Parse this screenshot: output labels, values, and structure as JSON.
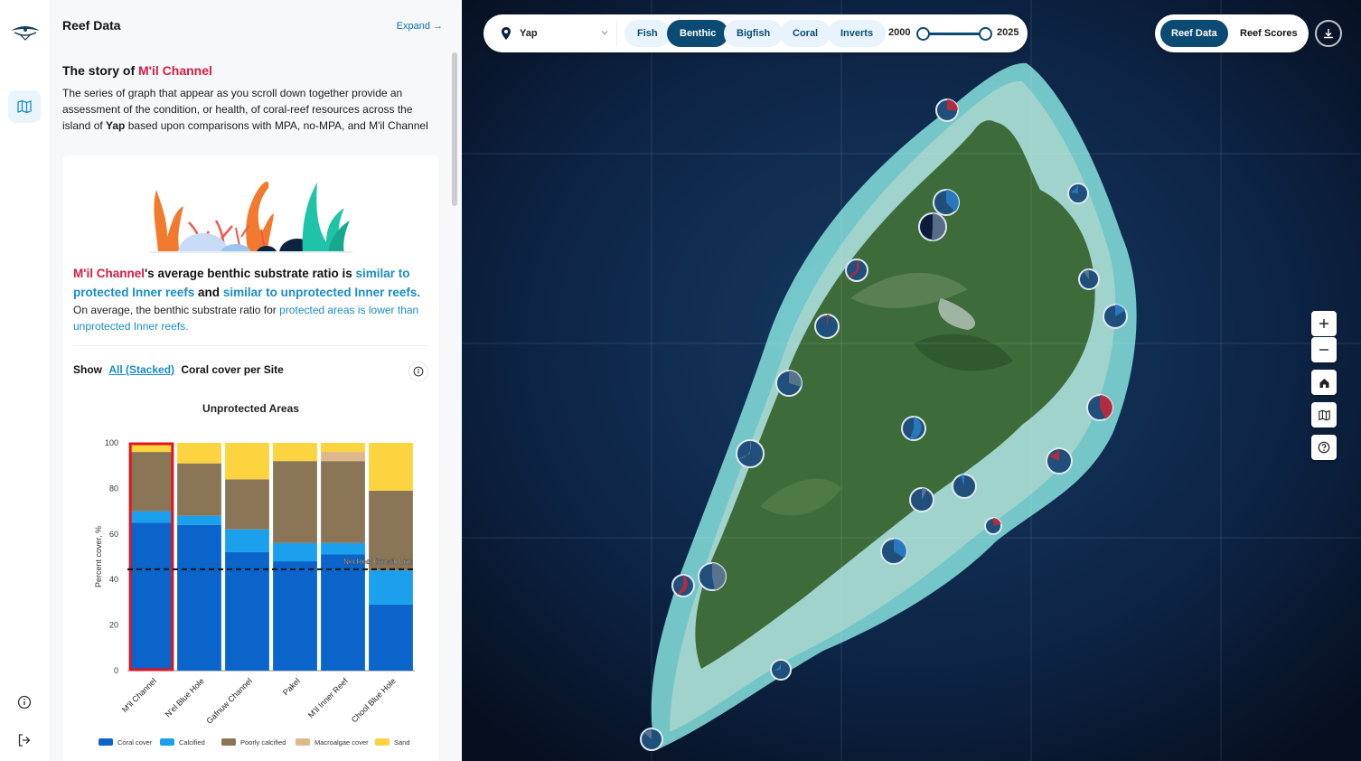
{
  "panel": {
    "title": "Reef Data",
    "expand": "Expand →"
  },
  "story": {
    "prefix": "The story of ",
    "site": "M'il Channel",
    "text_a": "The series of graph that appear as you scroll down together provide an assessment of the condition, or health, of coral-reef resources across the island of ",
    "island": "Yap",
    "text_b": " based upon comparisons with MPA, no-MPA, and M'il Channel"
  },
  "card": {
    "h_site": "M'il Channel",
    "h_a": "'s average benthic substrate ratio is ",
    "h_link1": "similar to protected Inner reefs",
    "h_and": " and ",
    "h_link2": "similar to unprotected Inner reefs.",
    "sub_a": "On average, the benthic substrate ratio for ",
    "sub_link": "protected areas is lower than unprotected Inner reefs.",
    "show": "Show",
    "show_sel": "All (Stacked)",
    "show_rest": "Coral cover per Site"
  },
  "chart_data": {
    "type": "bar",
    "stacked": true,
    "title": "Unprotected Areas",
    "ylabel": "Percent cover, %",
    "xlabel": "",
    "ylim": [
      0,
      100
    ],
    "yticks": [
      0,
      20,
      40,
      60,
      80,
      100
    ],
    "categories": [
      "M'il Channel",
      "N'el Blue Hole",
      "Gafnuw Channel",
      "Pakel",
      "M'il Inner Reef",
      "Chool Blue Hole"
    ],
    "highlight": "M'il Channel",
    "reference_line": {
      "label": "Net Reef Growth Line",
      "value": 44.5
    },
    "series": [
      {
        "name": "Coral cover",
        "color": "#0a64c9",
        "values": [
          65,
          64,
          52,
          48,
          51,
          29
        ]
      },
      {
        "name": "Calcified",
        "color": "#1aa0ec",
        "values": [
          5,
          4,
          10,
          8,
          5,
          15
        ]
      },
      {
        "name": "Poorly calcified",
        "color": "#8a7556",
        "values": [
          26,
          23,
          22,
          36,
          36,
          35
        ]
      },
      {
        "name": "Macroalgae cover",
        "color": "#ddb88d",
        "values": [
          0,
          0,
          0,
          0,
          4,
          0
        ]
      },
      {
        "name": "Sand",
        "color": "#fbd43f",
        "values": [
          4,
          9,
          16,
          8,
          4,
          21
        ]
      }
    ]
  },
  "map": {
    "location": "Yap",
    "layers": [
      "Fish",
      "Benthic",
      "Bigfish",
      "Coral",
      "Inverts"
    ],
    "active_layer": "Benthic",
    "year_start": "2000",
    "year_end": "2025",
    "views": [
      "Reef Data",
      "Reef Scores"
    ],
    "active_view": "Reef Data"
  },
  "icons": {
    "rail": [
      "map-icon",
      "info-icon",
      "logout-icon"
    ],
    "map_controls": [
      "zoom-in-icon",
      "zoom-out-icon",
      "home-icon",
      "map-icon",
      "help-icon"
    ]
  }
}
